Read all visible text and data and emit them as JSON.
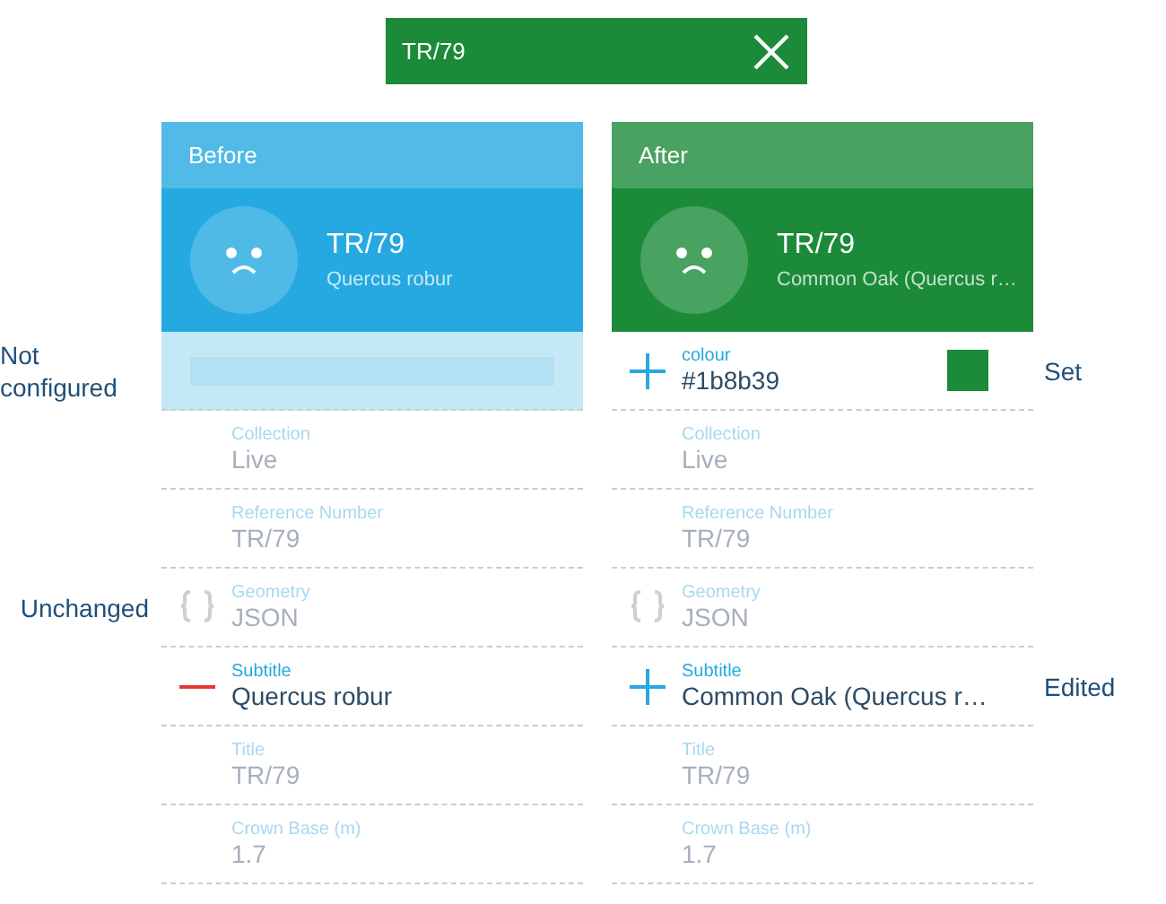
{
  "top_bar": {
    "title": "TR/79"
  },
  "panels": [
    {
      "heading": "Before",
      "title": "TR/79",
      "subtitle": "Quercus robur",
      "color": "#25a9e0"
    },
    {
      "heading": "After",
      "title": "TR/79",
      "subtitle": "Common Oak (Quercus r…",
      "color": "#1b8b39"
    }
  ],
  "rows": [
    {
      "note_left": "Not configured",
      "note_right": "Set",
      "before": {
        "kind": "empty"
      },
      "after": {
        "kind": "added",
        "changed": true,
        "label": "colour",
        "value": "#1b8b39",
        "color": "#1b8b39"
      }
    },
    {
      "before": {
        "kind": "plain",
        "changed": false,
        "label": "Collection",
        "value": "Live"
      },
      "after": {
        "kind": "plain",
        "changed": false,
        "label": "Collection",
        "value": "Live"
      }
    },
    {
      "before": {
        "kind": "plain",
        "changed": false,
        "label": "Reference Number",
        "value": "TR/79"
      },
      "after": {
        "kind": "plain",
        "changed": false,
        "label": "Reference Number",
        "value": "TR/79"
      }
    },
    {
      "note_left": "Unchanged",
      "before": {
        "kind": "json",
        "changed": false,
        "label": "Geometry",
        "value": "JSON"
      },
      "after": {
        "kind": "json",
        "changed": false,
        "label": "Geometry",
        "value": "JSON"
      }
    },
    {
      "note_right": "Edited",
      "before": {
        "kind": "removed",
        "changed": true,
        "label": "Subtitle",
        "value": "Quercus robur"
      },
      "after": {
        "kind": "added",
        "changed": true,
        "label": "Subtitle",
        "value": "Common Oak (Quercus r…"
      }
    },
    {
      "before": {
        "kind": "plain",
        "changed": false,
        "label": "Title",
        "value": "TR/79"
      },
      "after": {
        "kind": "plain",
        "changed": false,
        "label": "Title",
        "value": "TR/79"
      }
    },
    {
      "before": {
        "kind": "plain",
        "changed": false,
        "label": "Crown Base (m)",
        "value": "1.7"
      },
      "after": {
        "kind": "plain",
        "changed": false,
        "label": "Crown Base (m)",
        "value": "1.7"
      }
    }
  ]
}
